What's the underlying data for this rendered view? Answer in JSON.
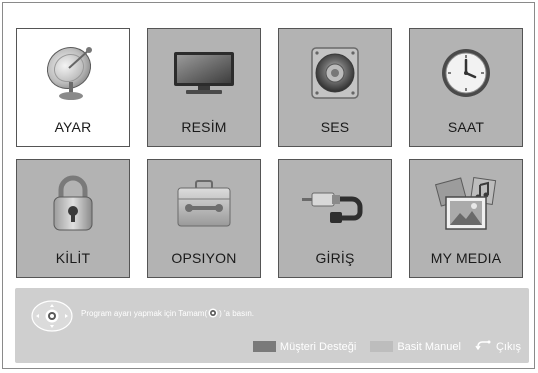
{
  "menu": {
    "tiles": [
      {
        "label": "AYAR",
        "icon": "satellite-dish-icon",
        "selected": true
      },
      {
        "label": "RESİM",
        "icon": "tv-monitor-icon",
        "selected": false
      },
      {
        "label": "SES",
        "icon": "speaker-icon",
        "selected": false
      },
      {
        "label": "SAAT",
        "icon": "clock-icon",
        "selected": false
      },
      {
        "label": "KİLİT",
        "icon": "padlock-icon",
        "selected": false
      },
      {
        "label": "OPSIYON",
        "icon": "toolbox-icon",
        "selected": false
      },
      {
        "label": "GİRİŞ",
        "icon": "av-cable-icon",
        "selected": false
      },
      {
        "label": "MY MEDIA",
        "icon": "media-photos-icon",
        "selected": false
      }
    ]
  },
  "help": {
    "text_before": "Program ayarı yapmak için Tamam(",
    "text_after": ") 'a basın."
  },
  "legend": {
    "support": {
      "label": "Müşteri Desteği",
      "color": "#7a7a7a"
    },
    "manual": {
      "label": "Basit Manuel",
      "color": "#bdbdbd"
    },
    "exit": {
      "label": "Çıkış",
      "icon": "back-arrow-icon"
    }
  },
  "colors": {
    "tile_bg": "#b3b3b3",
    "selected_bg": "#ffffff",
    "bar_bg": "#cfcfcf"
  }
}
